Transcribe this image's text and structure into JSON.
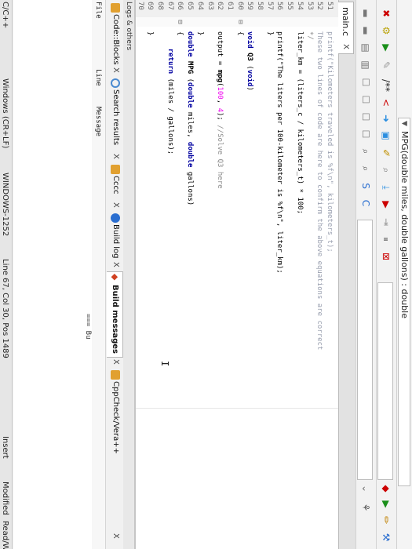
{
  "function_selector": "MPG(double miles, double gallons) : double",
  "toolbar": {
    "comment_label": "/**",
    "search_label": "S",
    "c_label": "C"
  },
  "editor": {
    "tab_label": "main.c",
    "tab_close": "X",
    "lines": [
      {
        "n": "51",
        "fold": "",
        "html_key": "l51"
      },
      {
        "n": "52",
        "fold": "",
        "html_key": "l52"
      },
      {
        "n": "53",
        "fold": "",
        "html_key": "l53"
      },
      {
        "n": "54",
        "fold": "",
        "html_key": "l54"
      },
      {
        "n": "55",
        "fold": "",
        "html_key": "l55"
      },
      {
        "n": "56",
        "fold": "",
        "html_key": "l56"
      },
      {
        "n": "57",
        "fold": "",
        "html_key": "l57"
      },
      {
        "n": "58",
        "fold": "",
        "html_key": "l58"
      },
      {
        "n": "59",
        "fold": "",
        "html_key": "l59"
      },
      {
        "n": "60",
        "fold": "⊟",
        "html_key": "l60"
      },
      {
        "n": "61",
        "fold": "",
        "html_key": "l61"
      },
      {
        "n": "62",
        "fold": "",
        "html_key": "l62"
      },
      {
        "n": "63",
        "fold": "",
        "html_key": "l63"
      },
      {
        "n": "64",
        "fold": "",
        "html_key": "l64"
      },
      {
        "n": "65",
        "fold": "",
        "html_key": "l65"
      },
      {
        "n": "66",
        "fold": "⊟",
        "html_key": "l66"
      },
      {
        "n": "67",
        "fold": "",
        "html_key": "l67"
      },
      {
        "n": "68",
        "fold": "",
        "html_key": "l68"
      },
      {
        "n": "69",
        "fold": "",
        "html_key": "l69"
      },
      {
        "n": "70",
        "fold": "",
        "html_key": "l70"
      }
    ],
    "code": {
      "l51": [
        [
          "dim",
          "printf(\"Kilometers traveled is %f\\n\", kilometers_t);"
        ]
      ],
      "l52": [
        [
          "dim",
          "These two lines of code are here to confirm the above equations are correct"
        ]
      ],
      "l53": [
        [
          "cmt",
          "*/"
        ]
      ],
      "l54": [
        [
          "",
          "liter_km = (liters_c / kilometers_t) * 100;"
        ]
      ],
      "l55": [
        [
          "",
          ""
        ]
      ],
      "l56": [
        [
          "",
          "printf(\"The liters per 100-kilometer is %f\\n\", liter_km);"
        ]
      ],
      "l57": [
        [
          "",
          "}"
        ]
      ],
      "l58": [
        [
          "",
          ""
        ]
      ],
      "l59": [
        [
          "kw",
          "void"
        ],
        [
          "",
          " "
        ],
        [
          "fn",
          "Q3"
        ],
        [
          "",
          " ("
        ],
        [
          "kw",
          "void"
        ],
        [
          "",
          ")"
        ]
      ],
      "l60": [
        [
          "",
          "{"
        ]
      ],
      "l61": [
        [
          "",
          ""
        ]
      ],
      "l62": [
        [
          "",
          "output = "
        ],
        [
          "fn",
          "mpg"
        ],
        [
          "",
          "("
        ],
        [
          "num",
          "100"
        ],
        [
          "",
          ", "
        ],
        [
          "num",
          "4"
        ],
        [
          "",
          "); "
        ],
        [
          "cmt",
          "//Solve Q3 here"
        ]
      ],
      "l63": [
        [
          "",
          ""
        ]
      ],
      "l64": [
        [
          "",
          "}"
        ]
      ],
      "l65": [
        [
          "kw",
          "double"
        ],
        [
          "",
          " "
        ],
        [
          "fn",
          "MPG"
        ],
        [
          "",
          " ("
        ],
        [
          "kw",
          "double"
        ],
        [
          "",
          " miles, "
        ],
        [
          "kw",
          "double"
        ],
        [
          "",
          " gallons)"
        ]
      ],
      "l66": [
        [
          "",
          "{"
        ]
      ],
      "l67": [
        [
          "",
          "    "
        ],
        [
          "kw",
          "return"
        ],
        [
          "",
          " (miles / gallons);"
        ]
      ],
      "l68": [
        [
          "",
          ""
        ]
      ],
      "l69": [
        [
          "",
          "}"
        ]
      ],
      "l70": [
        [
          "",
          ""
        ]
      ]
    },
    "cursor_glyph": "I"
  },
  "logs": {
    "title": "Logs & others",
    "tabs": [
      {
        "label": "Code::Blocks",
        "close": "X"
      },
      {
        "label": "Search results",
        "close": "X"
      },
      {
        "label": "Cccc",
        "close": "X"
      },
      {
        "label": "Build log",
        "close": "X"
      },
      {
        "label": "Build messages",
        "close": "X"
      },
      {
        "label": "CppCheck/Vera++",
        "close": ""
      }
    ],
    "panel_close": "X",
    "columns": {
      "file": "File",
      "line": "Line",
      "message": "Message"
    },
    "message_partial": "=== Bu"
  },
  "status": {
    "language": "C/C++",
    "eol": "Windows (CR+LF)",
    "encoding": "WINDOWS-1252",
    "position": "Line 67, Col 30, Pos 1489",
    "mode": "Insert",
    "modified": "Modified",
    "rw": "Read/W"
  },
  "colors": {
    "keyword": "#0000a0",
    "number": "#f000f0",
    "comment": "#8a8a8a"
  }
}
